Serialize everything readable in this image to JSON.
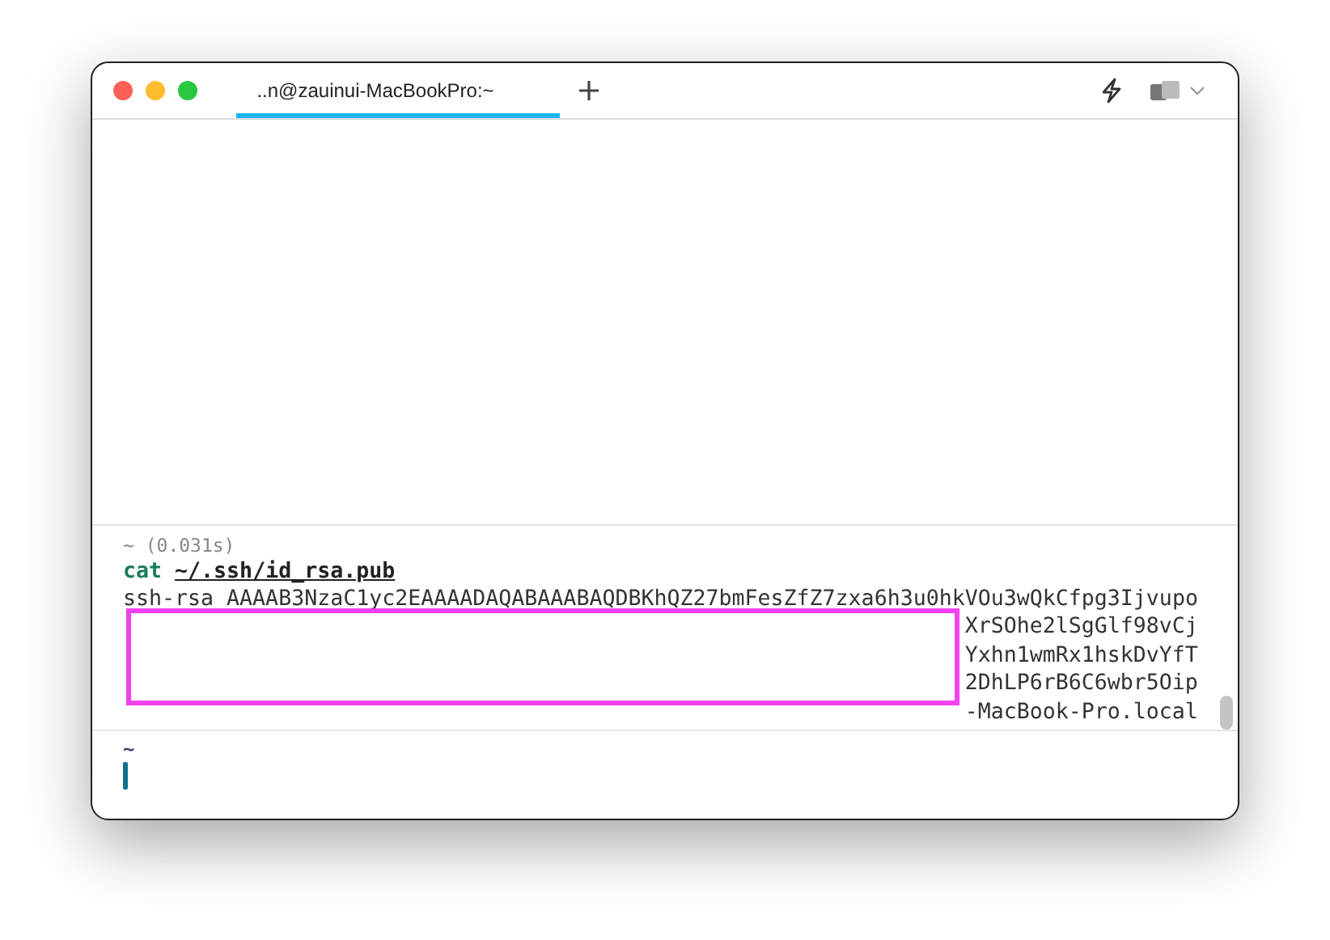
{
  "window": {
    "tabs": [
      {
        "label": "..n@zauinui-MacBookPro:~",
        "selected": true
      }
    ]
  },
  "block": {
    "meta": "~ (0.031s)",
    "command": "cat",
    "argument": "~/.ssh/id_rsa.pub",
    "output": [
      "ssh-rsa AAAAB3NzaC1yc2EAAAADAQABAAABAQDBKhQZ27bmFesZfZ7zxa6h3u0hkVOu3wQkCfpg3Ijvupo",
      "XrSOhe2lSgGlf98vCj",
      "Yxhn1wmRx1hskDvYfT",
      "2DhLP6rB6C6wbr5Oip",
      "-MacBook-Pro.local"
    ],
    "redacted": true
  },
  "prompt": {
    "text": "~"
  }
}
